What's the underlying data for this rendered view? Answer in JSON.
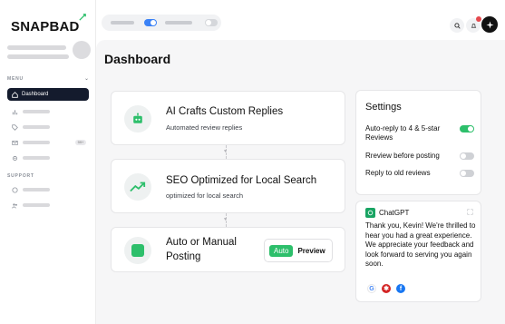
{
  "brand": {
    "name": "SNAPBAD",
    "accent": "#2dbf6b"
  },
  "sidebar": {
    "menu_label": "MENU",
    "support_label": "SUPPORT",
    "active_item": {
      "label": "Dashboard",
      "icon": "home-icon"
    },
    "items": [
      {
        "icon": "chart-icon"
      },
      {
        "icon": "tag-icon"
      },
      {
        "icon": "mail-icon",
        "badge": "99+"
      },
      {
        "icon": "gear-icon"
      }
    ],
    "support_items": [
      {
        "icon": "help-icon"
      },
      {
        "icon": "team-icon"
      }
    ]
  },
  "main": {
    "title": "Dashboard",
    "features": [
      {
        "title": "AI Crafts Custom Replies",
        "subtitle": "Automated review replies",
        "icon": "robot-icon"
      },
      {
        "title": "SEO Optimized for Local Search",
        "subtitle": "optimized for local search",
        "icon": "trend-up-icon"
      },
      {
        "title_line1": "Auto or Manual",
        "title_line2": "Posting",
        "icon": "square-app-icon",
        "auto_label": "Auto",
        "preview_label": "Preview"
      }
    ]
  },
  "settings": {
    "title": "Settings",
    "rows": [
      {
        "label": "Auto-reply to 4 & 5-star Reviews",
        "on": true
      },
      {
        "label": "Rreview before posting",
        "on": false
      },
      {
        "label": "Reply to old reviews",
        "on": false
      }
    ]
  },
  "chat": {
    "name": "ChatGPT",
    "message": "Thank you, Kevin! We're thrilled to hear you had a great experience. We appreciate your feedback and look forward to serving you again soon.",
    "sources": [
      "google-icon",
      "yelp-icon",
      "facebook-icon"
    ]
  }
}
